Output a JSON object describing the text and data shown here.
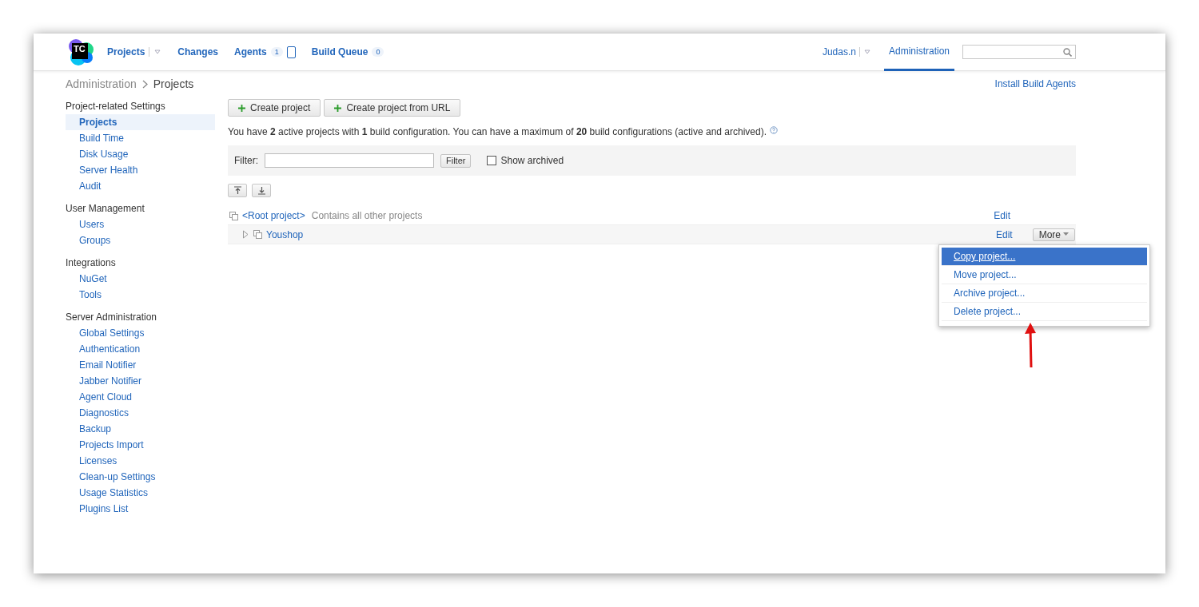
{
  "logo": {
    "text": "TC"
  },
  "nav": [
    {
      "label": "Projects",
      "kind": "menu"
    },
    {
      "label": "Changes",
      "kind": "link"
    },
    {
      "label": "Agents",
      "kind": "count-device",
      "count": "1"
    },
    {
      "label": "Build Queue",
      "kind": "count",
      "count": "0"
    }
  ],
  "user": {
    "name": "Judas.n"
  },
  "admin_tab": {
    "label": "Administration",
    "selected": true
  },
  "breadcrumb": [
    "Administration",
    "Projects"
  ],
  "install_link": "Install Build Agents",
  "sidebar": [
    {
      "title": "Project-related Settings",
      "items": [
        {
          "label": "Projects",
          "selected": true
        },
        {
          "label": "Build Time",
          "selected": false
        },
        {
          "label": "Disk Usage",
          "selected": false
        },
        {
          "label": "Server Health",
          "selected": false
        },
        {
          "label": "Audit",
          "selected": false
        }
      ]
    },
    {
      "title": "User Management",
      "items": [
        {
          "label": "Users",
          "selected": false
        },
        {
          "label": "Groups",
          "selected": false
        }
      ]
    },
    {
      "title": "Integrations",
      "items": [
        {
          "label": "NuGet",
          "selected": false
        },
        {
          "label": "Tools",
          "selected": false
        }
      ]
    },
    {
      "title": "Server Administration",
      "items": [
        {
          "label": "Global Settings",
          "selected": false
        },
        {
          "label": "Authentication",
          "selected": false
        },
        {
          "label": "Email Notifier",
          "selected": false
        },
        {
          "label": "Jabber Notifier",
          "selected": false
        },
        {
          "label": "Agent Cloud",
          "selected": false
        },
        {
          "label": "Diagnostics",
          "selected": false
        },
        {
          "label": "Backup",
          "selected": false
        },
        {
          "label": "Projects Import",
          "selected": false
        },
        {
          "label": "Licenses",
          "selected": false
        },
        {
          "label": "Clean-up Settings",
          "selected": false
        },
        {
          "label": "Usage Statistics",
          "selected": false
        },
        {
          "label": "Plugins List",
          "selected": false
        }
      ]
    }
  ],
  "buttons": [
    "Create project",
    "Create project from URL"
  ],
  "summary": "You have **2** active projects with **1** build configuration. You can have a maximum of **20** build configurations (active and archived).",
  "filter": {
    "label": "Filter:",
    "button": "Filter",
    "show_archived": {
      "label": "Show archived",
      "checked": false
    }
  },
  "projects": [
    {
      "name": "<Root project>",
      "description": "Contains all other projects",
      "edit": "Edit",
      "children": [
        {
          "name": "Youshop",
          "edit": "Edit",
          "more": "More",
          "expanded": false
        }
      ]
    }
  ],
  "more_menu": [
    {
      "label": "Copy project...",
      "selected": true
    },
    {
      "label": "Move project...",
      "selected": false
    },
    {
      "label": "Archive project...",
      "selected": false
    },
    {
      "label": "Delete project...",
      "selected": false
    }
  ]
}
